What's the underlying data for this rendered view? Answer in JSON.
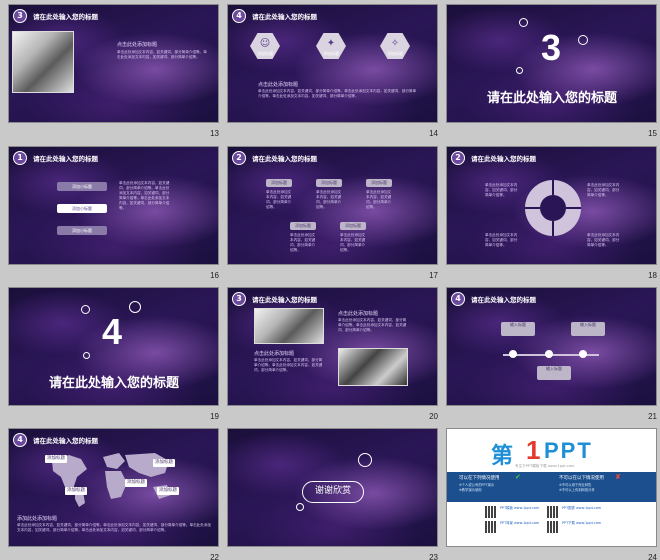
{
  "slides": [
    {
      "num": "13",
      "badge": "3",
      "title": "请在此处输入您的标题",
      "sub": "点击此处添加标题",
      "body": "单击此处添加文本内容，如关键词、部分简单介绍等。单击此处添加文本内容，如关键词、部分简单介绍等。"
    },
    {
      "num": "14",
      "badge": "4",
      "title": "请在此处输入您的标题",
      "hex_labels": [
        "添加标题",
        "添加标题",
        "添加标题"
      ],
      "sub": "点击此处添加标题",
      "body": "单击此处添加文本内容，如关键词、部分简单介绍等。单击此处添加文本内容，如关键词、部分简单介绍等。单击此处添加文本内容，如关键词、部分简单介绍等。"
    },
    {
      "num": "15",
      "big": "3",
      "title": "请在此处输入您的标题"
    },
    {
      "num": "16",
      "badge": "1",
      "title": "请在此处输入您的标题",
      "pills": [
        "添加小标题",
        "添加小标题",
        "添加小标题"
      ],
      "body": "单击此处添加文本内容，如关键词、部分简单介绍等。单击此处添加文本内容，如关键词、部分简单介绍等。单击此处添加文本内容，如关键词、部分简单介绍等。"
    },
    {
      "num": "17",
      "badge": "2",
      "title": "请在此处输入您的标题",
      "boxes": [
        "添加标题",
        "添加标题",
        "添加标题",
        "添加标题",
        "添加标题"
      ],
      "body": "单击此处添加文本内容，如关键词、部分简单介绍等。"
    },
    {
      "num": "18",
      "badge": "2",
      "title": "请在此处输入您的标题",
      "body": "单击此处添加文本内容，如关键词、部分简单介绍等。"
    },
    {
      "num": "19",
      "big": "4",
      "title": "请在此处输入您的标题"
    },
    {
      "num": "20",
      "badge": "3",
      "title": "请在此处输入您的标题",
      "sub": "点击添加标题",
      "sub2": "点击此处添加标题",
      "body": "单击此处添加文本内容，如关键词、部分简单介绍等。单击此处添加文本内容，如关键词、部分简单介绍等。"
    },
    {
      "num": "21",
      "badge": "4",
      "title": "请在此处输入您的标题",
      "boxes": [
        "输入标题",
        "输入标题",
        "输入标题"
      ],
      "body": "单击此处添加文本内容，如关键词、部分简单介绍等。"
    },
    {
      "num": "22",
      "badge": "4",
      "title": "请在此处输入您的标题",
      "tags": [
        "添加标题",
        "添加标题",
        "添加标题",
        "添加标题",
        "添加标题"
      ],
      "sub": "添加此处添加标题",
      "body": "单击此处添加文本内容，如关键词、部分简单介绍等。单击此处添加文本内容，如关键词、部分简单介绍等。单击此处添加文本内容，如关键词、部分简单介绍等。单击此处添加文本内容，如关键词、部分简单介绍等。"
    },
    {
      "num": "23",
      "thanks": "谢谢欣赏"
    },
    {
      "num": "24",
      "logo_a": "第",
      "logo_b": "1",
      "logo_c": "PPT",
      "logo_sub": "专注于PPT模板下载 www.1ppt.com",
      "left_h": "可以在下列情况使用",
      "right_h": "不可以在以下情况使用",
      "left_t": "※个人或公司的PPT演示\n※教学演示使用",
      "right_t": "※不可以用于商业转售\n※不可以上传到网络分享",
      "links": [
        "PPT模板 www.1ppt.com",
        "PPT背景 www.1ppt.com",
        "PPT图表 www.1ppt.com",
        "PPT下载 www.1ppt.com"
      ]
    }
  ]
}
